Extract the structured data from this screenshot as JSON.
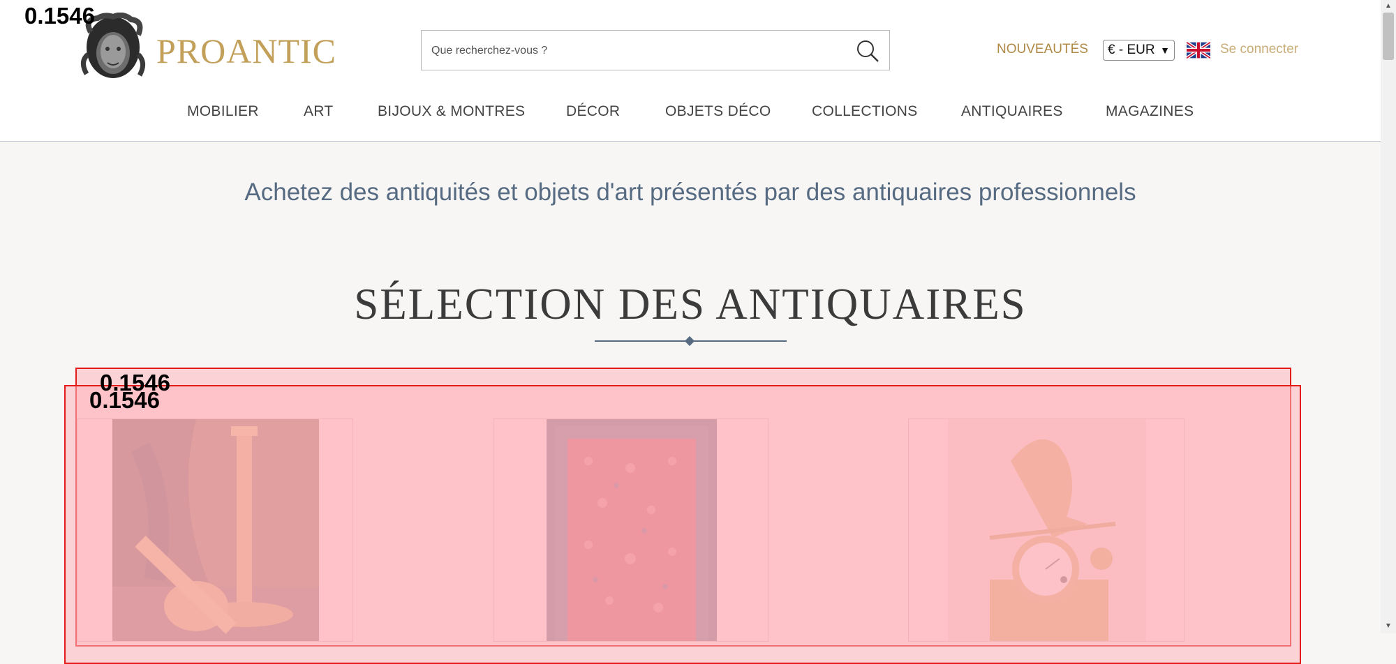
{
  "header": {
    "brand": "PROANTIC",
    "search": {
      "placeholder": "Que recherchez-vous ?"
    },
    "new_link": "NOUVEAUTÉS",
    "currency": "€ - EUR",
    "language_flag": "uk-flag-icon",
    "login": "Se connecter"
  },
  "nav": {
    "items": [
      {
        "label": "MOBILIER"
      },
      {
        "label": "ART"
      },
      {
        "label": "BIJOUX & MONTRES"
      },
      {
        "label": "DÉCOR"
      },
      {
        "label": "OBJETS DÉCO"
      },
      {
        "label": "COLLECTIONS"
      },
      {
        "label": "ANTIQUAIRES"
      },
      {
        "label": "MAGAZINES"
      }
    ]
  },
  "main": {
    "tagline": "Achetez des antiquités et objets d'art présentés par des antiquaires professionnels",
    "section_title": "SÉLECTION DES ANTIQUAIRES",
    "products": [
      {
        "image": "gilt-candlesticks-image"
      },
      {
        "image": "red-persian-rug-image"
      },
      {
        "image": "gilt-bronze-clock-image"
      }
    ]
  },
  "overlay": {
    "scores": [
      "0.1546",
      "0.1546",
      "0.1546"
    ],
    "box_color": "#e31b1b"
  },
  "colors": {
    "brand_gold": "#c2a05a",
    "nav_text": "#444444",
    "tagline_blue": "#566b82",
    "page_bg": "#f7f6f4"
  }
}
